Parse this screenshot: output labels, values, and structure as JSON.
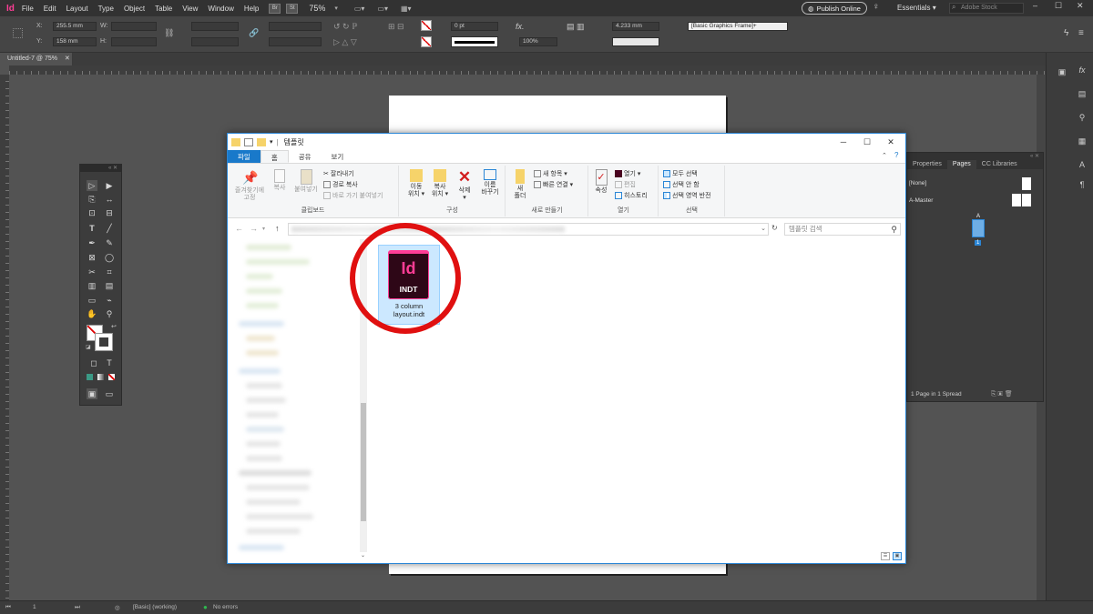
{
  "app": {
    "logo": "Id",
    "menu": [
      "File",
      "Edit",
      "Layout",
      "Type",
      "Object",
      "Table",
      "View",
      "Window",
      "Help"
    ],
    "bridge": "Br",
    "stock": "St",
    "zoom": "75%",
    "publish_online": "Publish Online",
    "workspace": "Essentials",
    "stock_search_placeholder": "Adobe Stock"
  },
  "control": {
    "x_label": "X:",
    "x_value": "255.5 mm",
    "y_label": "Y:",
    "y_value": "158 mm",
    "w_label": "W:",
    "h_label": "H:",
    "stroke_weight": "0 pt",
    "scale": "100%",
    "gap": "4.233 mm",
    "object_style": "[Basic Graphics Frame]+"
  },
  "document": {
    "tab_title": "Untitled-7 @ 75%",
    "close": "✕"
  },
  "pages_panel": {
    "tabs": [
      "Properties",
      "Pages",
      "CC Libraries"
    ],
    "active_tab": "Pages",
    "none_label": "[None]",
    "master_label": "A-Master",
    "page_number": "1",
    "page_master_letter": "A",
    "footer": "1 Page in 1 Spread"
  },
  "status": {
    "page": "1",
    "preflight_profile": "[Basic] (working)",
    "errors": "No errors"
  },
  "explorer": {
    "title": "템플릿",
    "ribbon_tabs": [
      "파일",
      "홈",
      "공유",
      "보기"
    ],
    "active_tab": "홈",
    "groups": {
      "clipboard": {
        "name": "클립보드",
        "pin": "즐겨찾기에\n고정",
        "copy": "복사",
        "paste": "붙여넣기",
        "cut": "잘라내기",
        "copy_path": "경로 복사",
        "paste_shortcut": "바로 가기 붙여넣기"
      },
      "organize": {
        "name": "구성",
        "move_to": "이동\n위치 ▾",
        "copy_to": "복사\n위치 ▾",
        "delete": "삭제\n▾",
        "rename": "이름\n바꾸기"
      },
      "new": {
        "name": "새로 만들기",
        "new_folder": "새\n폴더",
        "new_item": "새 항목 ▾",
        "easy_access": "빠른 연결 ▾"
      },
      "open": {
        "name": "열기",
        "properties": "속성",
        "open": "열기 ▾",
        "edit": "편집",
        "history": "히스토리"
      },
      "select": {
        "name": "선택",
        "select_all": "모두 선택",
        "select_none": "선택 안 함",
        "invert": "선택 영역 반전"
      }
    },
    "search_placeholder": "템플릿 검색",
    "file": {
      "icon_letters": "Id",
      "icon_ext": "INDT",
      "name": "3 column\nlayout.indt"
    },
    "colors": {
      "accent": "#1979ca",
      "indesign_pink": "#ff3d96",
      "highlight_ring": "#e01010"
    }
  }
}
